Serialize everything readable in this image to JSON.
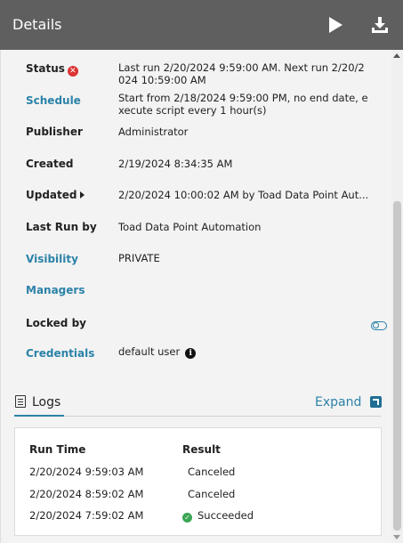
{
  "header": {
    "title": "Details",
    "play_icon": "play-icon",
    "download_icon": "download-icon"
  },
  "fields": {
    "status": {
      "label": "Status",
      "icon": "error-x-icon",
      "value_line1": "Last run 2/20/2024 9:59:00 AM. Next run 2/20/2",
      "value_line2": "024 10:59:00 AM"
    },
    "schedule": {
      "label": "Schedule",
      "value_line1": "Start from 2/18/2024 9:59:00 PM, no end date, e",
      "value_line2": "xecute script every 1 hour(s)"
    },
    "publisher": {
      "label": "Publisher",
      "value": "Administrator"
    },
    "created": {
      "label": "Created",
      "value": "2/19/2024 8:34:35 AM"
    },
    "updated": {
      "label": "Updated",
      "value": "2/20/2024 10:00:02 AM by Toad Data Point Aut..."
    },
    "last_run_by": {
      "label": "Last Run by",
      "value": "Toad Data Point Automation"
    },
    "visibility": {
      "label": "Visibility",
      "value": "PRIVATE"
    },
    "managers": {
      "label": "Managers",
      "value": ""
    },
    "locked_by": {
      "label": "Locked by",
      "value": ""
    },
    "credentials": {
      "label": "Credentials",
      "value": "default user"
    }
  },
  "logs": {
    "tab_label": "Logs",
    "expand_label": "Expand",
    "columns": [
      "Run Time",
      "Result"
    ],
    "rows": [
      {
        "time": "2/20/2024 9:59:03 AM",
        "result": "Canceled",
        "icon": ""
      },
      {
        "time": "2/20/2024 8:59:02 AM",
        "result": "Canceled",
        "icon": ""
      },
      {
        "time": "2/20/2024 7:59:02 AM",
        "result": "Succeeded",
        "icon": "check-icon"
      }
    ]
  },
  "colors": {
    "header_bg": "#5f5f5f",
    "link": "#2b82a8",
    "error": "#dd3333",
    "success": "#3aa655"
  }
}
